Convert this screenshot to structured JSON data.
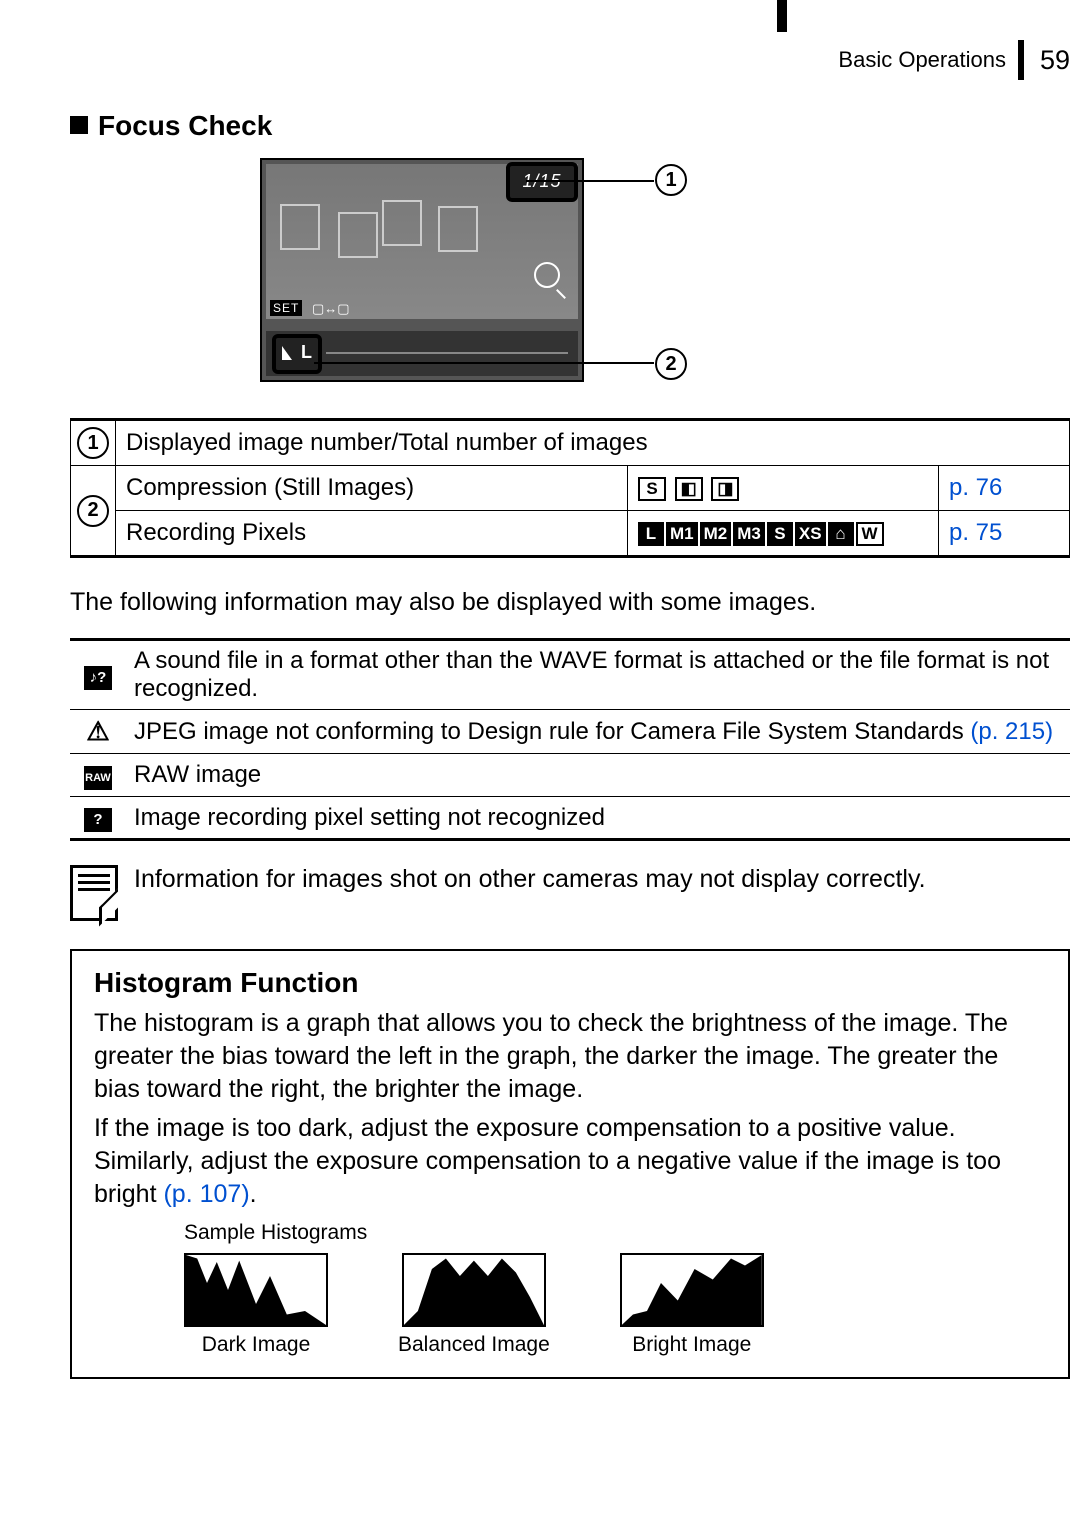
{
  "header": {
    "section": "Basic Operations",
    "page": "59"
  },
  "focus_check": {
    "title": "Focus Check",
    "counter": "1/15",
    "set_label": "SET"
  },
  "legend": {
    "row1": {
      "num": "1",
      "desc": "Displayed image number/Total number of images"
    },
    "row2": {
      "num": "2",
      "compression_label": "Compression (Still Images)",
      "compression_icons": [
        "S",
        "◧",
        "◨"
      ],
      "compression_page": "p. 76",
      "pixels_label": "Recording Pixels",
      "pixels_icons": [
        "L",
        "M1",
        "M2",
        "M3",
        "S",
        "XS",
        "⌂",
        "W"
      ],
      "pixels_page": "p. 75"
    }
  },
  "body_note": "The following information may also be displayed with some images.",
  "info_rows": {
    "sound": {
      "icon": "♪?",
      "text": "A sound file in a format other than the WAVE format is attached or the file format is not recognized."
    },
    "jpeg": {
      "icon": "⚠",
      "text_prefix": "JPEG image not conforming to Design rule for Camera File System Standards ",
      "page": "(p. 215)"
    },
    "raw": {
      "icon": "RAW",
      "text": "RAW image"
    },
    "unknown": {
      "icon": "?",
      "text": "Image recording pixel setting not recognized"
    }
  },
  "camera_note": "Information for images shot on other cameras may not display correctly.",
  "histogram": {
    "title": "Histogram Function",
    "p1": "The histogram is a graph that allows you to check the brightness of the image. The greater the bias toward the left in the graph, the darker the image. The greater the bias toward the right, the brighter the image.",
    "p2_prefix": "If the image is too dark, adjust the exposure compensation to a positive value. Similarly, adjust the exposure compensation to a negative value if the image is too bright ",
    "p2_page": "(p. 107)",
    "p2_suffix": ".",
    "samples_title": "Sample Histograms",
    "samples": {
      "dark": "Dark Image",
      "balanced": "Balanced Image",
      "bright": "Bright Image"
    }
  }
}
